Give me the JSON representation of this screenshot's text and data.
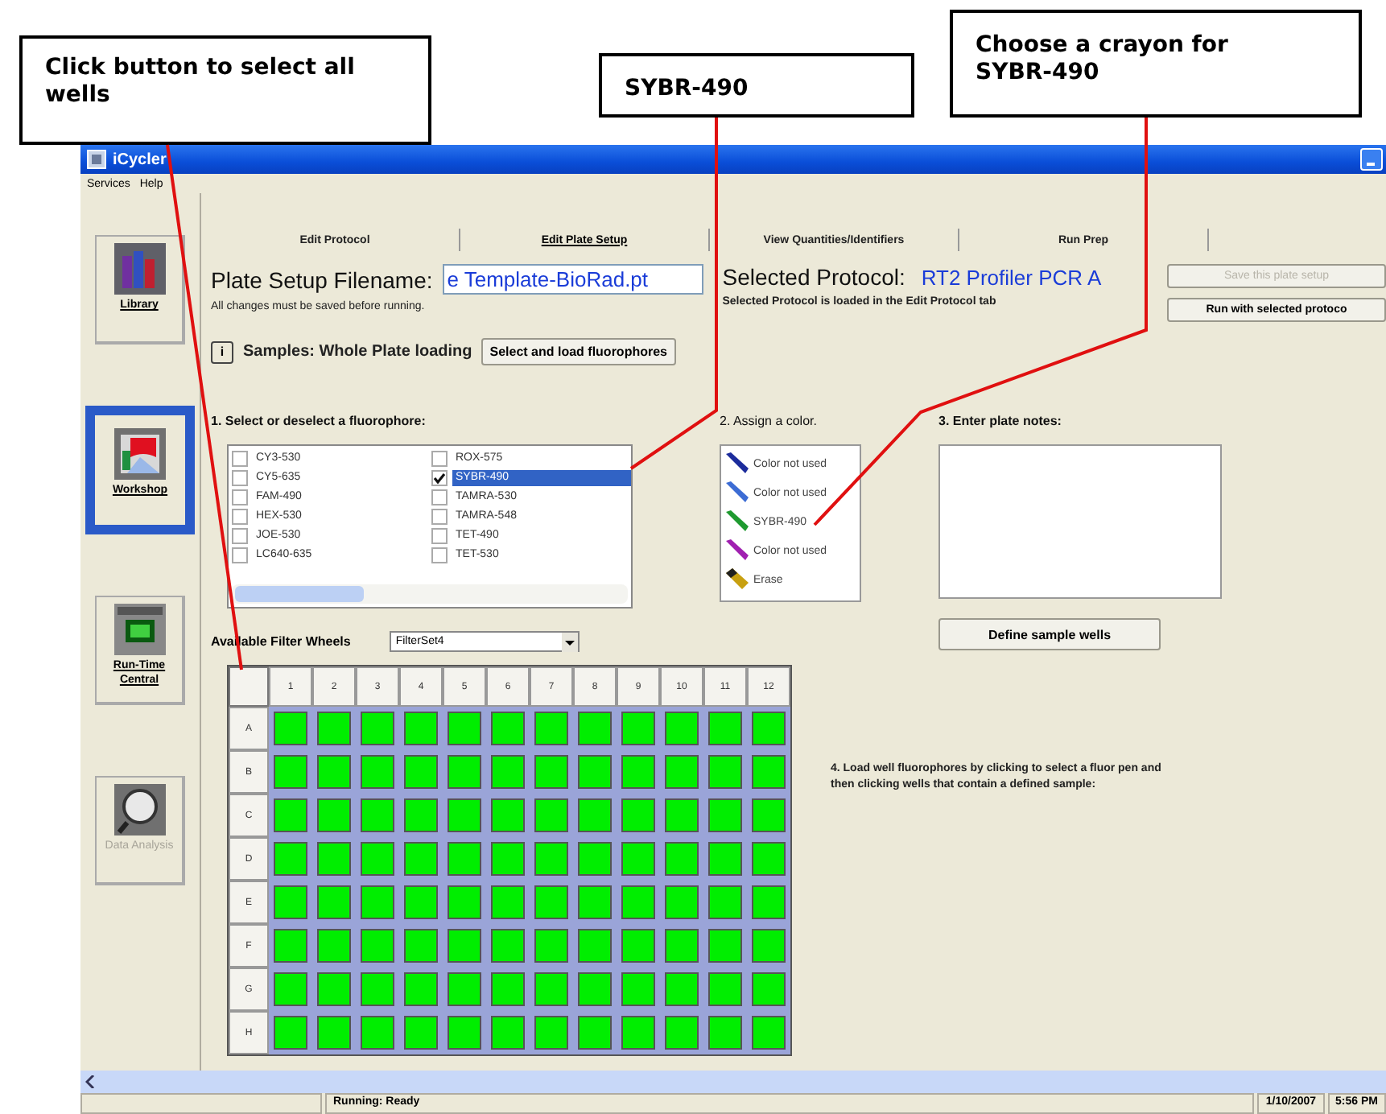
{
  "callouts": [
    {
      "text": "Click button to select all wells"
    },
    {
      "text": "SYBR-490"
    },
    {
      "text": "Choose a crayon for SYBR-490"
    }
  ],
  "window": {
    "title": "iCycler"
  },
  "menu": [
    "Services",
    "Help"
  ],
  "sidebar": [
    {
      "label": "Library",
      "kind": "library",
      "selected": false,
      "disabled": false
    },
    {
      "label": "Workshop",
      "kind": "workshop",
      "selected": true,
      "disabled": false
    },
    {
      "label": "Run-Time Central",
      "kind": "runtime",
      "selected": false,
      "disabled": false
    },
    {
      "label": "Data Analysis",
      "kind": "analysis",
      "selected": false,
      "disabled": true
    }
  ],
  "tabs": [
    {
      "label": "Edit Protocol",
      "selected": false
    },
    {
      "label": "Edit Plate Setup",
      "selected": true
    },
    {
      "label": "View Quantities/Identifiers",
      "selected": false
    },
    {
      "label": "Run Prep",
      "selected": false
    }
  ],
  "setup": {
    "filename_label": "Plate Setup Filename:",
    "filename_value": "e Template-BioRad.pt",
    "protocol_label": "Selected Protocol:",
    "protocol_value": "RT2 Profiler PCR A",
    "save_note": "All changes must be saved before running.",
    "protocol_note": "Selected Protocol is loaded in the Edit Protocol tab",
    "buttons": [
      {
        "label": "Save this plate setup",
        "disabled": true
      },
      {
        "label": "Run with selected protoco",
        "disabled": false
      }
    ]
  },
  "samples": {
    "info_icon": "i",
    "label": "Samples: Whole Plate loading",
    "button": "Select and load fluorophores"
  },
  "fluorophores": {
    "heading": "1.  Select or deselect a fluorophore:",
    "items": [
      {
        "label": "CY3-530",
        "checked": false,
        "selected": false
      },
      {
        "label": "CY5-635",
        "checked": false,
        "selected": false
      },
      {
        "label": "FAM-490",
        "checked": false,
        "selected": false
      },
      {
        "label": "HEX-530",
        "checked": false,
        "selected": false
      },
      {
        "label": "JOE-530",
        "checked": false,
        "selected": false
      },
      {
        "label": "LC640-635",
        "checked": false,
        "selected": false
      },
      {
        "label": "ROX-575",
        "checked": false,
        "selected": false
      },
      {
        "label": "SYBR-490",
        "checked": true,
        "selected": true
      },
      {
        "label": "TAMRA-530",
        "checked": false,
        "selected": false
      },
      {
        "label": "TAMRA-548",
        "checked": false,
        "selected": false
      },
      {
        "label": "TET-490",
        "checked": false,
        "selected": false
      },
      {
        "label": "TET-530",
        "checked": false,
        "selected": false
      }
    ]
  },
  "colors": {
    "heading": "2. Assign a color.",
    "items": [
      {
        "label": "Color not used",
        "kind": "crayon",
        "color": "#1c2c9c"
      },
      {
        "label": "Color not used",
        "kind": "crayon",
        "color": "#3c6cd4"
      },
      {
        "label": "SYBR-490",
        "kind": "crayon",
        "color": "#1f9a30"
      },
      {
        "label": "Color not used",
        "kind": "crayon",
        "color": "#a020b0"
      },
      {
        "label": "Erase",
        "kind": "eraser",
        "color": "#c8a010"
      }
    ]
  },
  "notes": {
    "heading": "3.  Enter plate notes:",
    "button": "Define sample wells"
  },
  "filter": {
    "label": "Available Filter Wheels",
    "value": "FilterSet4"
  },
  "plate": {
    "columns": [
      "1",
      "2",
      "3",
      "4",
      "5",
      "6",
      "7",
      "8",
      "9",
      "10",
      "11",
      "12"
    ],
    "rows": [
      {
        "label": "A",
        "loaded": [
          true,
          true,
          true,
          true,
          true,
          true,
          true,
          true,
          true,
          true,
          true,
          true
        ]
      },
      {
        "label": "B",
        "loaded": [
          true,
          true,
          true,
          true,
          true,
          true,
          true,
          true,
          true,
          true,
          true,
          true
        ]
      },
      {
        "label": "C",
        "loaded": [
          true,
          true,
          true,
          true,
          true,
          true,
          true,
          true,
          true,
          true,
          true,
          true
        ]
      },
      {
        "label": "D",
        "loaded": [
          true,
          true,
          true,
          true,
          true,
          true,
          true,
          true,
          true,
          true,
          true,
          true
        ]
      },
      {
        "label": "E",
        "loaded": [
          true,
          true,
          true,
          true,
          true,
          true,
          true,
          true,
          true,
          true,
          true,
          true
        ]
      },
      {
        "label": "F",
        "loaded": [
          true,
          true,
          true,
          true,
          true,
          true,
          true,
          true,
          true,
          true,
          true,
          true
        ]
      },
      {
        "label": "G",
        "loaded": [
          true,
          true,
          true,
          true,
          true,
          true,
          true,
          true,
          true,
          true,
          true,
          true
        ]
      },
      {
        "label": "H",
        "loaded": [
          true,
          true,
          true,
          true,
          true,
          true,
          true,
          true,
          true,
          true,
          true,
          true
        ]
      }
    ]
  },
  "instruction": "4. Load well fluorophores by clicking to select a fluor pen and then clicking wells that contain a defined sample:",
  "status_bar": {
    "status": "Running: Ready",
    "date": "1/10/2007",
    "time": "5:56 PM"
  }
}
